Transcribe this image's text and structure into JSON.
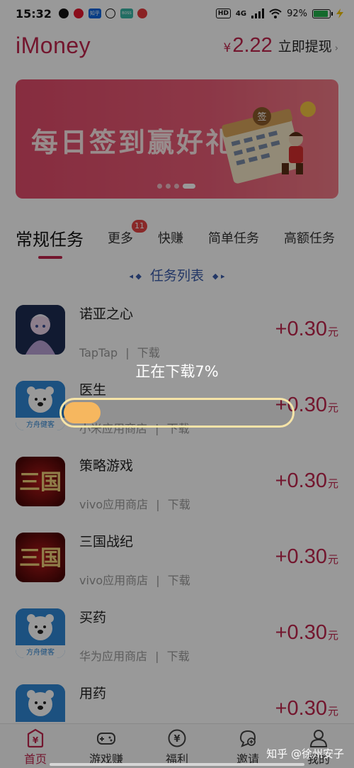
{
  "status_bar": {
    "time": "15:32",
    "app_icons": [
      "steam-icon",
      "weibo-icon",
      "zhihu-icon",
      "message-icon",
      "boss-icon",
      "app-icon"
    ],
    "zhihu_label": "知乎",
    "boss_label": "BOSS直聘",
    "network": "4G",
    "battery": "92%",
    "battery_level": 0.92
  },
  "header": {
    "logo": "iMoney",
    "balance_currency": "¥",
    "balance_amount": "2.22",
    "withdraw_label": "立即提现",
    "withdraw_chevron": "›"
  },
  "banner": {
    "title": "每日签到赢好礼",
    "sign_label": "签",
    "slide_count": 4,
    "active_slide": 4
  },
  "tabs": {
    "main": "常规任务",
    "items": [
      {
        "label": "更多",
        "badge": "11"
      },
      {
        "label": "快赚"
      },
      {
        "label": "简单任务"
      },
      {
        "label": "高额任务"
      }
    ]
  },
  "section": {
    "title": "任务列表",
    "left_arrows": "◂ ◆",
    "right_arrows": "◆ ▸"
  },
  "tasks": [
    {
      "name": "诺亚之心",
      "source": "TapTap",
      "separator": "|",
      "action": "下载",
      "reward": "+0.30",
      "unit": "元",
      "icon": "noah-icon"
    },
    {
      "name": "医生",
      "source": "小米应用商店",
      "separator": "|",
      "action": "下载",
      "reward": "+0.30",
      "unit": "元",
      "icon": "fangyao-icon",
      "icon_text": "方舟健客"
    },
    {
      "name": "策略游戏",
      "source": "vivo应用商店",
      "separator": "|",
      "action": "下载",
      "reward": "+0.30",
      "unit": "元",
      "icon": "sanguo-icon",
      "icon_text": "三国"
    },
    {
      "name": "三国战纪",
      "source": "vivo应用商店",
      "separator": "|",
      "action": "下载",
      "reward": "+0.30",
      "unit": "元",
      "icon": "sanguo-icon",
      "icon_text": "三国"
    },
    {
      "name": "买药",
      "source": "华为应用商店",
      "separator": "|",
      "action": "下载",
      "reward": "+0.30",
      "unit": "元",
      "icon": "fangyao-icon",
      "icon_text": "方舟健客"
    },
    {
      "name": "用药",
      "source": "",
      "separator": "",
      "action": "",
      "reward": "+0.30",
      "unit": "元",
      "icon": "fangyao-icon"
    }
  ],
  "bottom_nav": [
    {
      "label": "首页",
      "icon": "home-yuan-icon",
      "active": true
    },
    {
      "label": "游戏赚",
      "icon": "gamepad-icon"
    },
    {
      "label": "福利",
      "icon": "yuan-coin-icon"
    },
    {
      "label": "邀请",
      "icon": "invite-icon"
    },
    {
      "label": "我的",
      "icon": "user-icon"
    }
  ],
  "loading": {
    "text": "正在下载7%",
    "progress": 0.07
  },
  "watermark": "知乎 @徐州安子",
  "colors": {
    "brand": "#c0264d",
    "banner": "#e14b6a",
    "section_title": "#3b5caa",
    "progress_fill": "#f6b75f",
    "progress_border": "#f6e4a8",
    "badge": "#e54545"
  }
}
